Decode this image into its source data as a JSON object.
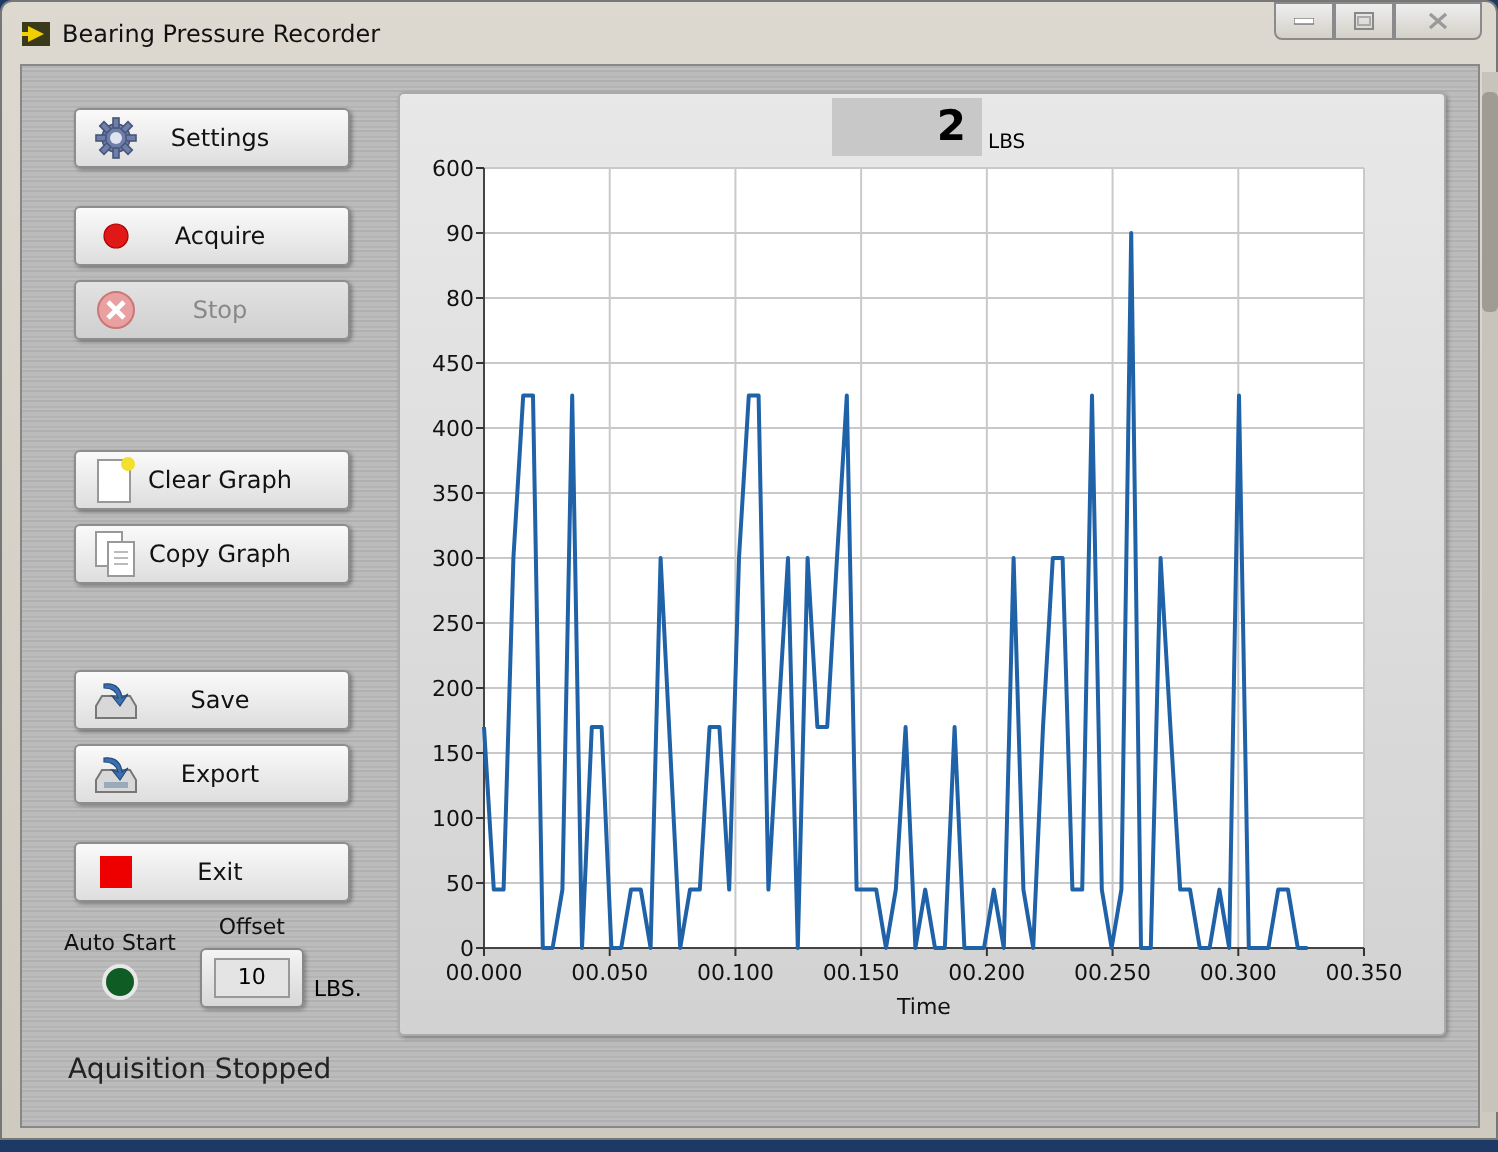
{
  "window": {
    "title": "Bearing Pressure Recorder"
  },
  "button_groups": [
    [
      {
        "label": "Settings",
        "kind": "gear",
        "disabled": false
      }
    ],
    [
      {
        "label": "Acquire",
        "kind": "record",
        "disabled": false
      },
      {
        "label": "Stop",
        "kind": "stop",
        "disabled": true
      }
    ],
    [
      {
        "label": "Clear Graph",
        "kind": "clear",
        "disabled": false
      },
      {
        "label": "Copy Graph",
        "kind": "copy",
        "disabled": false
      }
    ],
    [
      {
        "label": "Save",
        "kind": "save",
        "disabled": false
      },
      {
        "label": "Export",
        "kind": "export",
        "disabled": false
      }
    ],
    [
      {
        "label": "Exit",
        "kind": "exit",
        "disabled": false
      }
    ]
  ],
  "auto_start": {
    "label": "Auto Start",
    "on": true
  },
  "offset": {
    "label": "Offset",
    "value": "10",
    "unit": "LBS."
  },
  "status": "Aquisition Stopped",
  "graph": {
    "reading": {
      "value": "2",
      "unit": "LBS"
    },
    "overlapping_axis_labels": [
      "90",
      "80"
    ],
    "chart_data": {
      "type": "line",
      "xlabel": "Time",
      "xlim": [
        0,
        0.35
      ],
      "ylim": [
        0,
        600
      ],
      "xticks": [
        {
          "value": 0,
          "label": "00.000"
        },
        {
          "value": 0.05,
          "label": "00.050"
        },
        {
          "value": 0.1,
          "label": "00.100"
        },
        {
          "value": 0.15,
          "label": "00.150"
        },
        {
          "value": 0.2,
          "label": "00.200"
        },
        {
          "value": 0.25,
          "label": "00.250"
        },
        {
          "value": 0.3,
          "label": "00.300"
        },
        {
          "value": 0.35,
          "label": "00.350"
        }
      ],
      "yticks": [
        0,
        50,
        100,
        150,
        200,
        250,
        300,
        350,
        400,
        450,
        600
      ],
      "grid": true,
      "x": [
        0,
        0.0039,
        0.0078,
        0.0117,
        0.0156,
        0.0195,
        0.0234,
        0.0273,
        0.0312,
        0.0351,
        0.039,
        0.0429,
        0.0468,
        0.0507,
        0.0546,
        0.0585,
        0.0624,
        0.0663,
        0.0702,
        0.0741,
        0.078,
        0.0819,
        0.0858,
        0.0897,
        0.0936,
        0.0975,
        0.1014,
        0.1053,
        0.1092,
        0.1131,
        0.117,
        0.1209,
        0.1248,
        0.1287,
        0.1326,
        0.1365,
        0.1404,
        0.1443,
        0.1482,
        0.1521,
        0.156,
        0.1599,
        0.1638,
        0.1677,
        0.1716,
        0.1755,
        0.1794,
        0.1833,
        0.1872,
        0.1911,
        0.195,
        0.1989,
        0.2028,
        0.2067,
        0.2106,
        0.2145,
        0.2184,
        0.2223,
        0.2262,
        0.2301,
        0.234,
        0.2379,
        0.2418,
        0.2457,
        0.2496,
        0.2535,
        0.2574,
        0.2613,
        0.2652,
        0.2691,
        0.273,
        0.2769,
        0.2808,
        0.2847,
        0.2886,
        0.2925,
        0.2964,
        0.3003,
        0.3042,
        0.3081,
        0.312,
        0.3159,
        0.3198,
        0.3237,
        0.3276
      ],
      "series": [
        {
          "color": "#1f62a8",
          "values": [
            170,
            45,
            45,
            300,
            425,
            425,
            0,
            0,
            45,
            425,
            0,
            170,
            170,
            0,
            0,
            45,
            45,
            0,
            300,
            150,
            0,
            45,
            45,
            170,
            170,
            45,
            300,
            425,
            425,
            45,
            175,
            300,
            0,
            300,
            170,
            170,
            300,
            425,
            45,
            45,
            45,
            0,
            45,
            170,
            0,
            45,
            0,
            0,
            170,
            0,
            0,
            0,
            45,
            0,
            300,
            45,
            0,
            170,
            300,
            300,
            45,
            45,
            425,
            45,
            0,
            45,
            550,
            0,
            0,
            300,
            170,
            45,
            45,
            0,
            0,
            45,
            0,
            425,
            0,
            0,
            0,
            45,
            45,
            0,
            0
          ]
        }
      ]
    }
  }
}
